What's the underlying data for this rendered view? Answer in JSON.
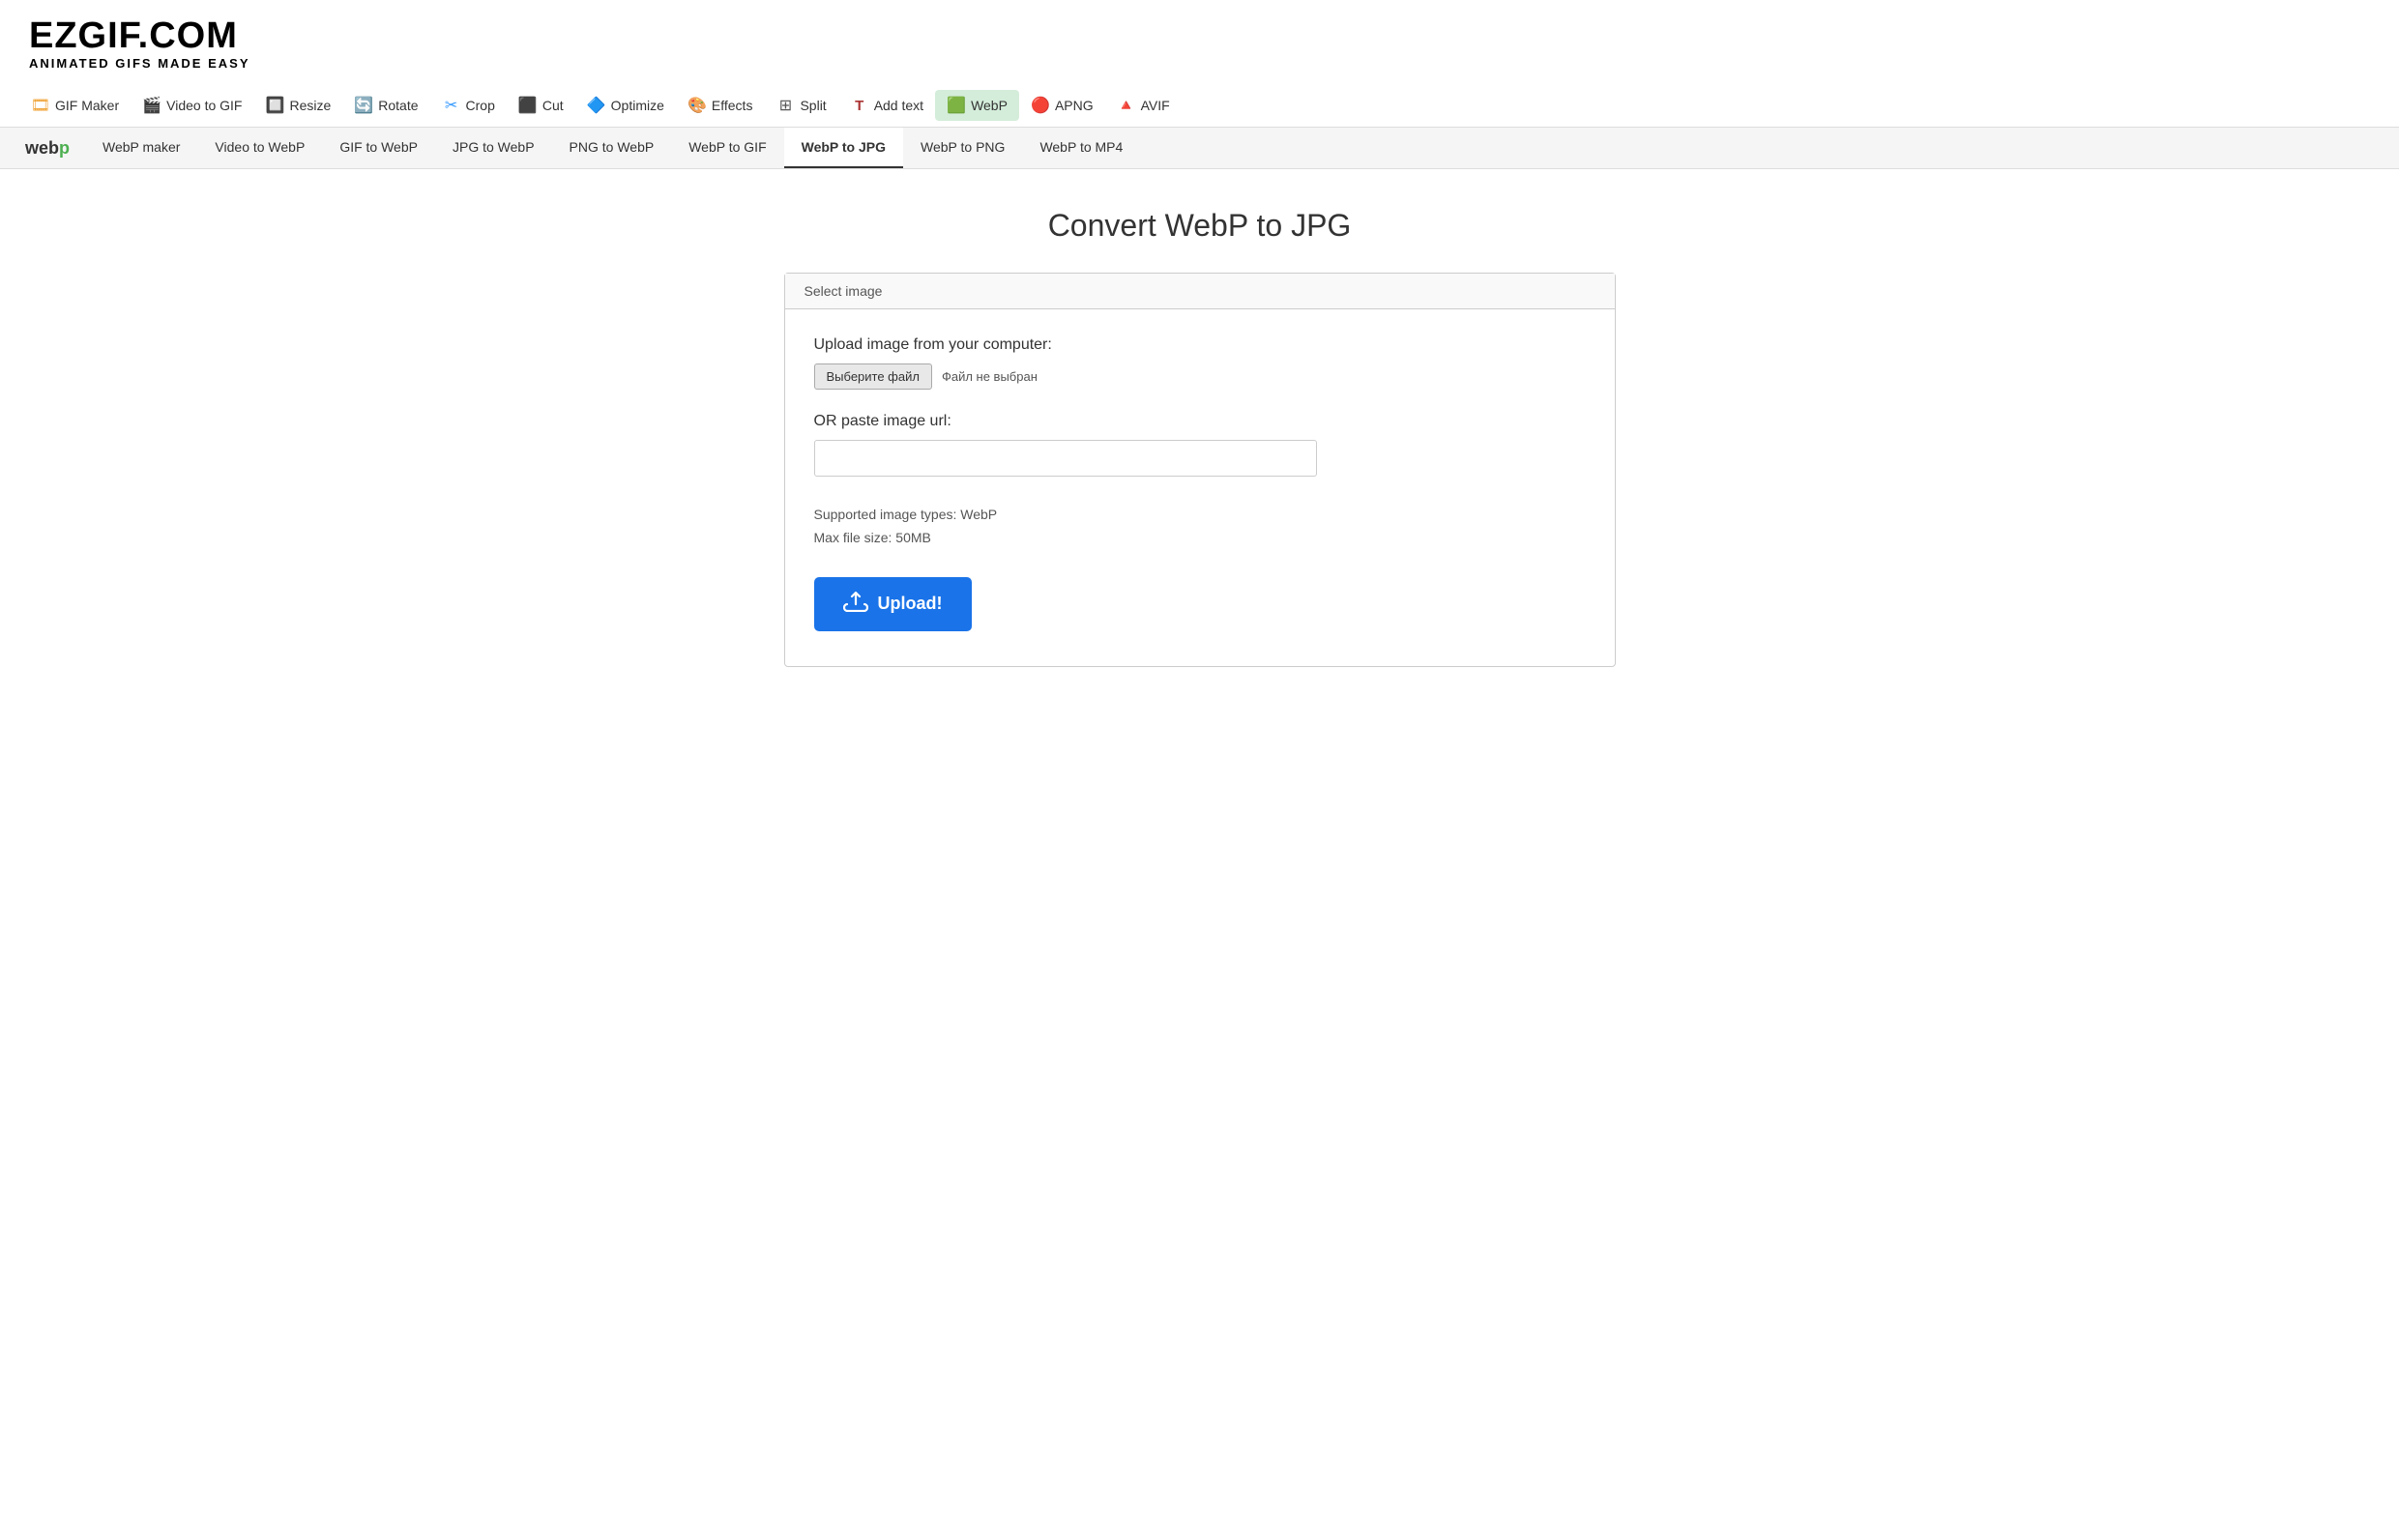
{
  "logo": {
    "title": "EZGIF.COM",
    "subtitle": "ANIMATED GIFS MADE EASY"
  },
  "nav": {
    "items": [
      {
        "id": "gif-maker",
        "label": "GIF Maker",
        "icon": "🎞"
      },
      {
        "id": "video-to-gif",
        "label": "Video to GIF",
        "icon": "🎬"
      },
      {
        "id": "resize",
        "label": "Resize",
        "icon": "🔲"
      },
      {
        "id": "rotate",
        "label": "Rotate",
        "icon": "🔄"
      },
      {
        "id": "crop",
        "label": "Crop",
        "icon": "✂"
      },
      {
        "id": "cut",
        "label": "Cut",
        "icon": "🔲"
      },
      {
        "id": "optimize",
        "label": "Optimize",
        "icon": "🔷"
      },
      {
        "id": "effects",
        "label": "Effects",
        "icon": "🎨"
      },
      {
        "id": "split",
        "label": "Split",
        "icon": "⊞"
      },
      {
        "id": "add-text",
        "label": "Add text",
        "icon": "T"
      },
      {
        "id": "webp",
        "label": "WebP",
        "icon": "🟩"
      },
      {
        "id": "apng",
        "label": "APNG",
        "icon": "🔴"
      },
      {
        "id": "avif",
        "label": "AVIF",
        "icon": "🔺"
      }
    ]
  },
  "sub_nav": {
    "logo_text_1": "web",
    "logo_text_2": "p",
    "tabs": [
      {
        "id": "webp-maker",
        "label": "WebP maker",
        "active": false
      },
      {
        "id": "video-to-webp",
        "label": "Video to WebP",
        "active": false
      },
      {
        "id": "gif-to-webp",
        "label": "GIF to WebP",
        "active": false
      },
      {
        "id": "jpg-to-webp",
        "label": "JPG to WebP",
        "active": false
      },
      {
        "id": "png-to-webp",
        "label": "PNG to WebP",
        "active": false
      },
      {
        "id": "webp-to-gif",
        "label": "WebP to GIF",
        "active": false
      },
      {
        "id": "webp-to-jpg",
        "label": "WebP to JPG",
        "active": true
      },
      {
        "id": "webp-to-png",
        "label": "WebP to PNG",
        "active": false
      },
      {
        "id": "webp-to-mp4",
        "label": "WebP to MP4",
        "active": false
      }
    ]
  },
  "page": {
    "title": "Convert WebP to JPG",
    "upload_box": {
      "header": "Select image",
      "upload_label": "Upload image from your computer:",
      "file_button_label": "Выберите файл",
      "file_no_chosen": "Файл не выбран",
      "url_label": "OR paste image url:",
      "url_placeholder": "",
      "supported_types": "Supported image types: WebP",
      "max_file_size": "Max file size: 50MB",
      "upload_button_label": "Upload!"
    }
  }
}
